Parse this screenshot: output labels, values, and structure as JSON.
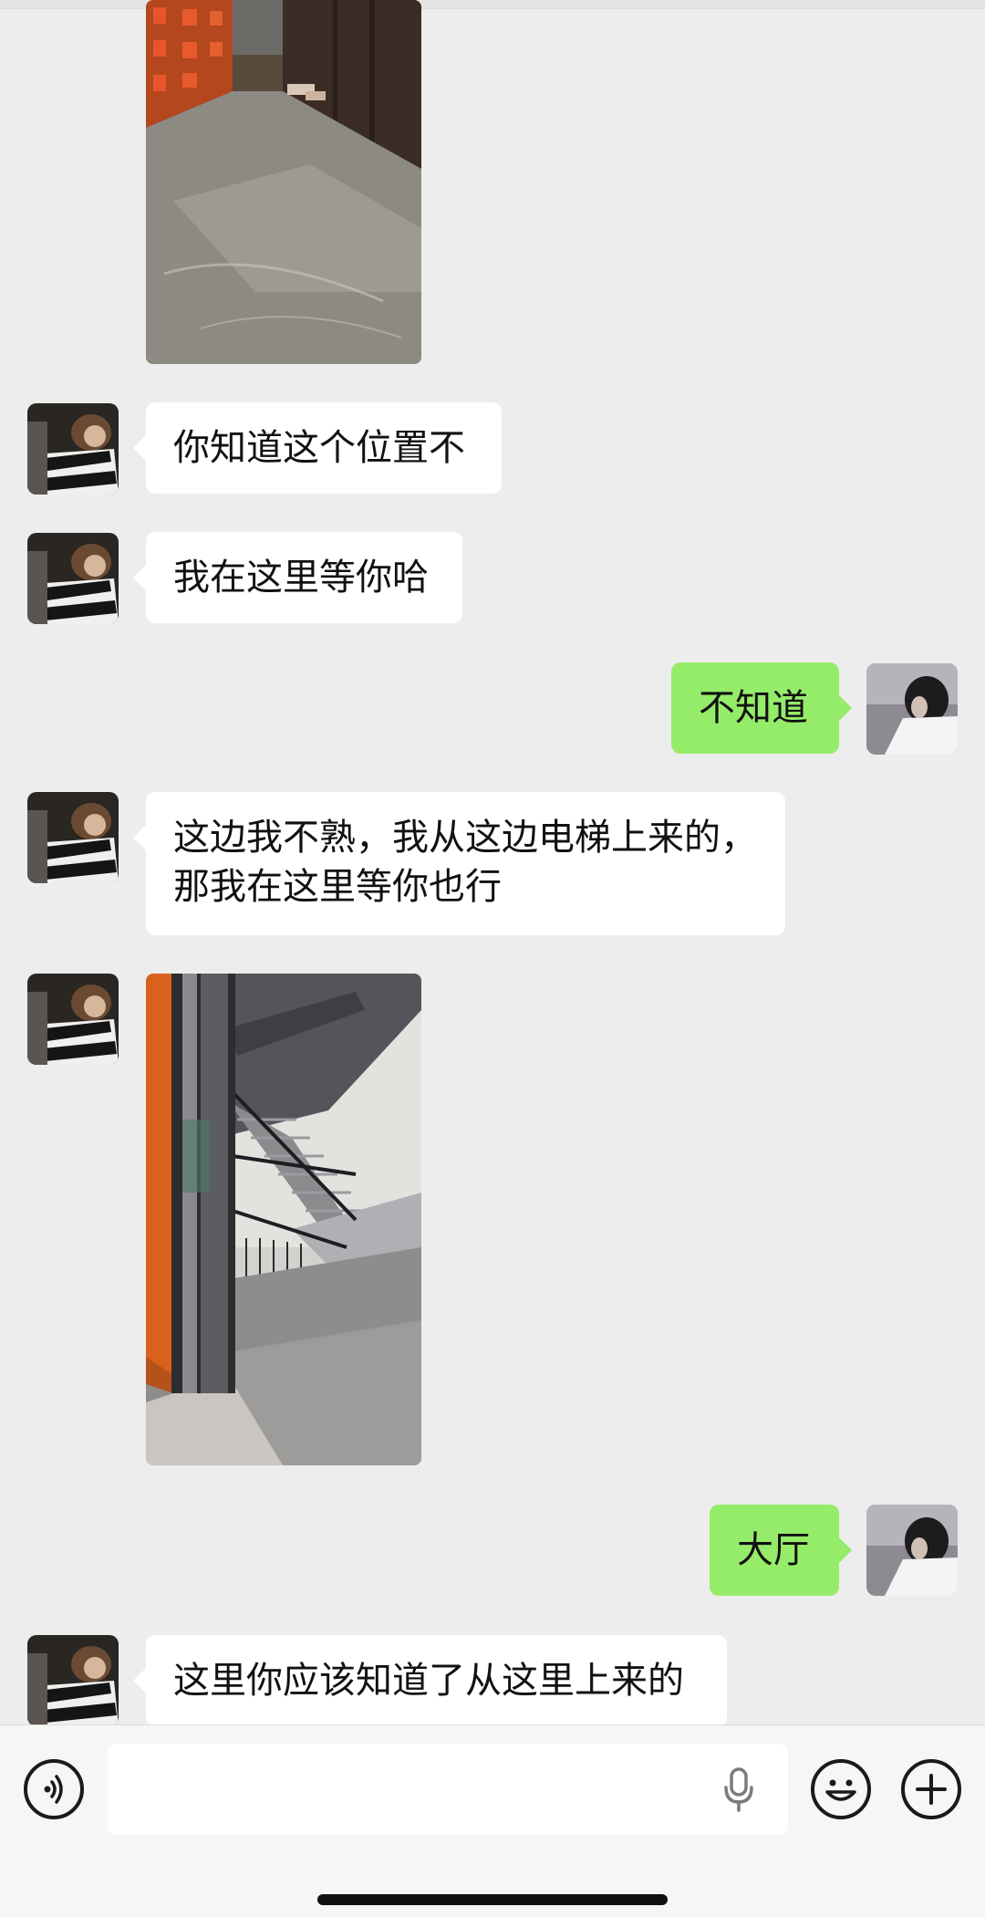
{
  "messages": {
    "m1_text": "你知道这个位置不",
    "m2_text": "我在这里等你哈",
    "m3_text": "不知道",
    "m4_line1": "这边我不熟，我从这边电梯上来的，",
    "m4_line2": "那我在这里等你也行",
    "m6_text": "大厅",
    "m7_text": "这里你应该知道了从这里上来的"
  },
  "input": {
    "placeholder": ""
  },
  "colors": {
    "background": "#ededed",
    "incoming_bubble": "#ffffff",
    "outgoing_bubble": "#95ec69",
    "input_bar": "#f6f6f6"
  },
  "icons": [
    "voice-mode-icon",
    "microphone-icon",
    "emoji-icon",
    "plus-icon"
  ]
}
